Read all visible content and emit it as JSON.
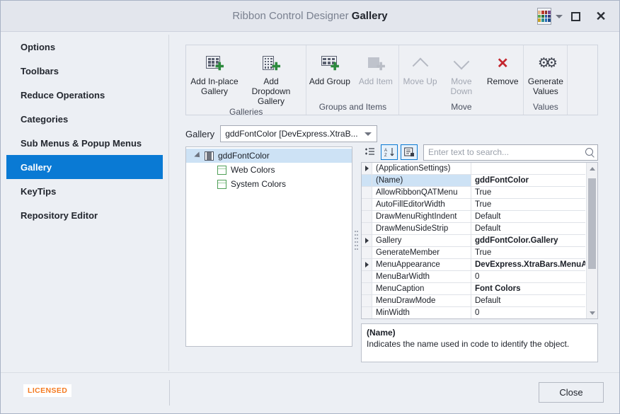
{
  "window": {
    "title_prefix": "Ribbon Control Designer",
    "title_strong": "Gallery",
    "palette_icon": "color-palette-icon",
    "maximize_icon": "maximize-icon",
    "close_icon": "close-icon"
  },
  "sidebar": {
    "items": [
      {
        "label": "Options",
        "selected": false
      },
      {
        "label": "Toolbars",
        "selected": false
      },
      {
        "label": "Reduce Operations",
        "selected": false
      },
      {
        "label": "Categories",
        "selected": false
      },
      {
        "label": "Sub Menus & Popup Menus",
        "selected": false
      },
      {
        "label": "Gallery",
        "selected": true
      },
      {
        "label": "KeyTips",
        "selected": false
      },
      {
        "label": "Repository Editor",
        "selected": false
      }
    ],
    "selected_color": "#0a7ad4"
  },
  "ribbon": {
    "groups": [
      {
        "name": "Galleries",
        "items": [
          {
            "label": "Add In-place Gallery",
            "icon": "add-grid-icon",
            "enabled": true
          },
          {
            "label": "Add Dropdown Gallery",
            "icon": "add-dropdown-grid-icon",
            "enabled": true
          }
        ]
      },
      {
        "name": "Groups and Items",
        "items": [
          {
            "label": "Add Group",
            "icon": "add-group-icon",
            "enabled": true
          },
          {
            "label": "Add Item",
            "icon": "add-item-icon",
            "enabled": false
          }
        ]
      },
      {
        "name": "Move",
        "items": [
          {
            "label": "Move Up",
            "icon": "chevron-up-icon",
            "enabled": false
          },
          {
            "label": "Move Down",
            "icon": "chevron-down-icon",
            "enabled": false
          },
          {
            "label": "Remove",
            "icon": "remove-x-icon",
            "enabled": true
          }
        ]
      },
      {
        "name": "Values",
        "items": [
          {
            "label": "Generate Values",
            "icon": "gears-icon",
            "enabled": true
          }
        ]
      },
      {
        "name": "",
        "items": []
      }
    ]
  },
  "gallery_selector": {
    "label": "Gallery",
    "value": "gddFontColor [DevExpress.XtraB...",
    "dropdown_icon": "chevron-down-icon"
  },
  "tree": {
    "nodes": [
      {
        "label": "gddFontColor",
        "level": 0,
        "icon": "gallery-node-icon",
        "selected": true,
        "expanded": true
      },
      {
        "label": "Web Colors",
        "level": 1,
        "icon": "gallery-group-icon",
        "selected": false
      },
      {
        "label": "System Colors",
        "level": 1,
        "icon": "gallery-group-icon",
        "selected": false
      }
    ]
  },
  "property_grid": {
    "toolbar": {
      "categorized_icon": "categorized-icon",
      "alphabetical_icon": "sort-alphabetical-icon",
      "properties_icon": "properties-page-icon",
      "alphabetical_active": true,
      "properties_active": true,
      "search_placeholder": "Enter text to search...",
      "search_value": "",
      "search_icon": "search-icon"
    },
    "rows": [
      {
        "name": "(ApplicationSettings)",
        "value": "",
        "expandable": true,
        "bold": false,
        "selected": false
      },
      {
        "name": "(Name)",
        "value": "gddFontColor",
        "expandable": false,
        "bold": true,
        "selected": true
      },
      {
        "name": "AllowRibbonQATMenu",
        "value": "True",
        "expandable": false,
        "bold": false,
        "selected": false
      },
      {
        "name": "AutoFillEditorWidth",
        "value": "True",
        "expandable": false,
        "bold": false,
        "selected": false
      },
      {
        "name": "DrawMenuRightIndent",
        "value": "Default",
        "expandable": false,
        "bold": false,
        "selected": false
      },
      {
        "name": "DrawMenuSideStrip",
        "value": "Default",
        "expandable": false,
        "bold": false,
        "selected": false
      },
      {
        "name": "Gallery",
        "value": "gddFontColor.Gallery",
        "expandable": true,
        "bold": true,
        "selected": false
      },
      {
        "name": "GenerateMember",
        "value": "True",
        "expandable": false,
        "bold": false,
        "selected": false
      },
      {
        "name": "MenuAppearance",
        "value": "DevExpress.XtraBars.MenuA",
        "expandable": true,
        "bold": true,
        "selected": false
      },
      {
        "name": "MenuBarWidth",
        "value": "0",
        "expandable": false,
        "bold": false,
        "selected": false
      },
      {
        "name": "MenuCaption",
        "value": "Font Colors",
        "expandable": false,
        "bold": true,
        "selected": false
      },
      {
        "name": "MenuDrawMode",
        "value": "Default",
        "expandable": false,
        "bold": false,
        "selected": false
      },
      {
        "name": "MinWidth",
        "value": "0",
        "expandable": false,
        "bold": false,
        "selected": false
      }
    ],
    "description": {
      "title": "(Name)",
      "text": "Indicates the name used in code to identify the object."
    },
    "scrollbar": {
      "up_icon": "scroll-up-icon",
      "down_icon": "scroll-down-icon"
    }
  },
  "footer": {
    "licensed_badge": "LICENSED",
    "licensed_color": "#f47a20",
    "close_label": "Close"
  }
}
